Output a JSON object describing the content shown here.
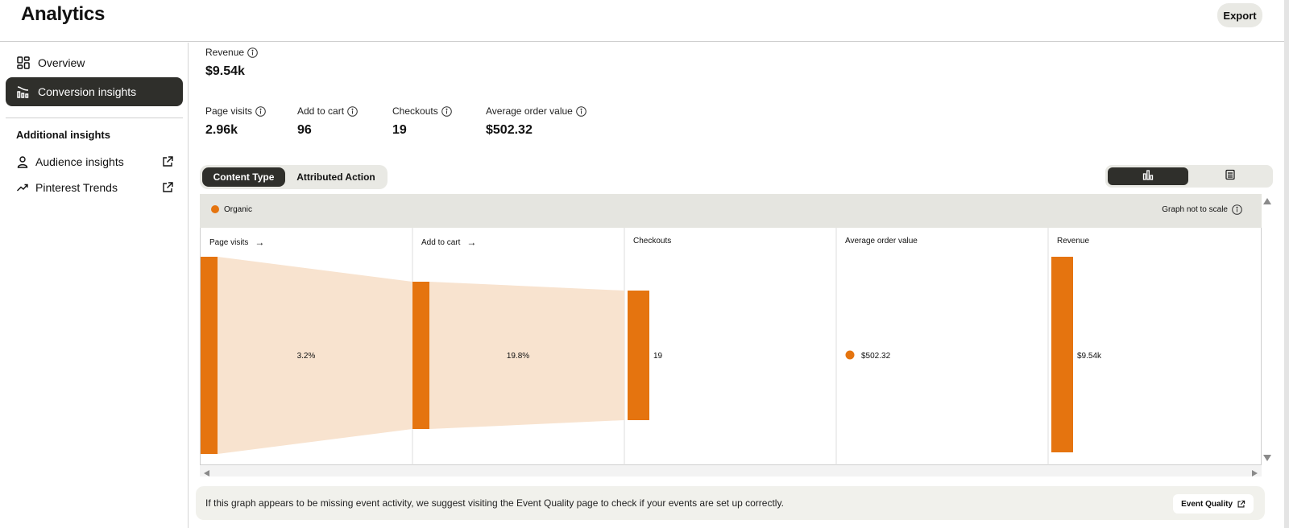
{
  "header": {
    "title": "Analytics",
    "export_label": "Export"
  },
  "sidebar": {
    "items": [
      {
        "label": "Overview",
        "icon": "grid-icon",
        "active": false
      },
      {
        "label": "Conversion insights",
        "icon": "funnel-chart-icon",
        "active": true
      }
    ],
    "additional_heading": "Additional insights",
    "external_items": [
      {
        "label": "Audience insights",
        "icon": "person-icon"
      },
      {
        "label": "Pinterest Trends",
        "icon": "trend-icon"
      }
    ]
  },
  "metrics": {
    "revenue": {
      "label": "Revenue",
      "value": "$9.54k"
    },
    "page_visits": {
      "label": "Page visits",
      "value": "2.96k"
    },
    "add_to_cart": {
      "label": "Add to cart",
      "value": "96"
    },
    "checkouts": {
      "label": "Checkouts",
      "value": "19"
    },
    "aov": {
      "label": "Average order value",
      "value": "$502.32"
    }
  },
  "tabs": {
    "content_type": "Content Type",
    "attributed_action": "Attributed Action"
  },
  "view_toggle": {
    "selected": "chart-view",
    "options": [
      "bar-chart-icon",
      "table-view-icon"
    ]
  },
  "legend": {
    "series": "Organic",
    "color": "#e5740f",
    "note": "Graph not to scale"
  },
  "chart_data": {
    "type": "bar",
    "categories": [
      "Page visits",
      "Add to cart",
      "Checkouts",
      "Average order value",
      "Revenue"
    ],
    "series": [
      {
        "name": "Organic",
        "values": [
          "2.96k",
          "96",
          "19",
          "$502.32",
          "$9.54k"
        ]
      }
    ],
    "conversion_rates": [
      "3.2%",
      "19.8%"
    ],
    "data_labels": {
      "checkouts": "19",
      "aov": "$502.32",
      "revenue": "$9.54k"
    },
    "not_to_scale": true,
    "colors": {
      "bar": "#e5740f",
      "flow": "#f8e3cf"
    }
  },
  "notice": {
    "text": "If this graph appears to be missing event activity, we suggest visiting the Event Quality page to check if your events are set up correctly.",
    "button": "Event Quality"
  }
}
